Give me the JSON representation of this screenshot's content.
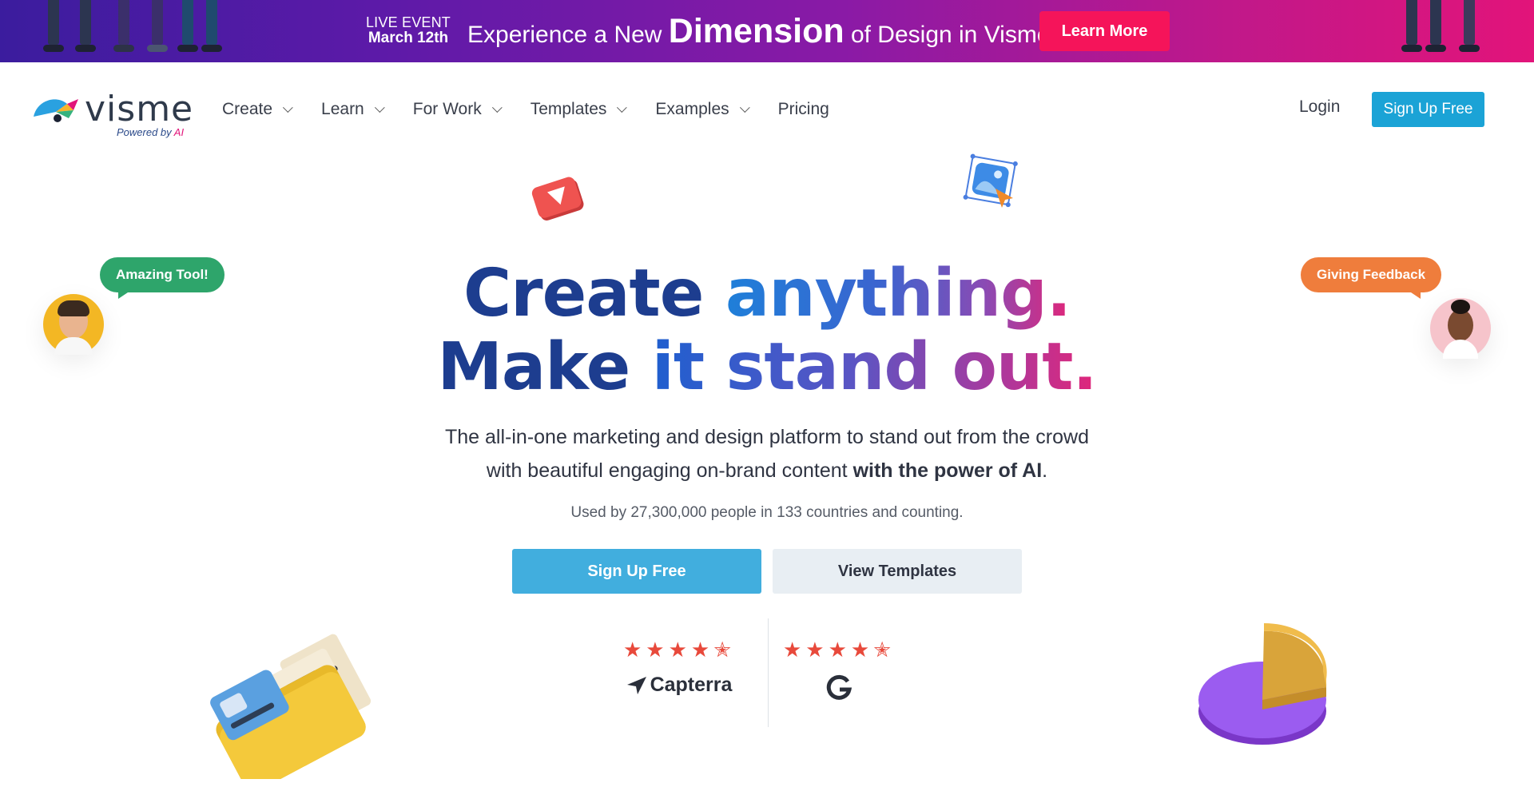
{
  "banner": {
    "event_line1": "LIVE EVENT",
    "event_line2": "March 12th",
    "headline_pre": "Experience a New ",
    "headline_big": "Dimension",
    "headline_post": " of Design in Visme",
    "cta_label": "Learn More",
    "cta_color": "#f5145a"
  },
  "nav": {
    "logo_word": "visme",
    "logo_sub_pre": "Powered by ",
    "logo_sub_ai": "AI",
    "menu": [
      {
        "label": "Create",
        "has_dropdown": true
      },
      {
        "label": "Learn",
        "has_dropdown": true
      },
      {
        "label": "For Work",
        "has_dropdown": true
      },
      {
        "label": "Templates",
        "has_dropdown": true
      },
      {
        "label": "Examples",
        "has_dropdown": true
      },
      {
        "label": "Pricing",
        "has_dropdown": false
      }
    ],
    "login_label": "Login",
    "signup_label": "Sign Up Free",
    "signup_color": "#1ba3d6"
  },
  "hero": {
    "title_l1_a": "Create ",
    "title_l1_b": "anything.",
    "title_l2_a": "Make ",
    "title_l2_b": "it stand out.",
    "sub_l1": "The all-in-one marketing and design platform to stand out from the crowd",
    "sub_l2_pre": "with beautiful engaging on-brand content ",
    "sub_l2_bold": "with the power of AI",
    "sub_l2_post": ".",
    "used_by": "Used by 27,300,000 people in 133 countries and counting.",
    "primary_cta": "Sign Up Free",
    "secondary_cta": "View Templates"
  },
  "ratings": [
    {
      "brand": "Capterra",
      "stars": 4.5,
      "star_icons": "★★★★"
    },
    {
      "brand": "G2",
      "stars": 4.5,
      "star_icons": "★★★★"
    }
  ],
  "floating": {
    "left_bubble": "Amazing Tool!",
    "right_bubble": "Giving Feedback"
  },
  "colors": {
    "navy": "#1d3d8f",
    "green_bubble": "#2ea56b",
    "orange_bubble": "#ef7d3c",
    "star": "#e8493b"
  }
}
